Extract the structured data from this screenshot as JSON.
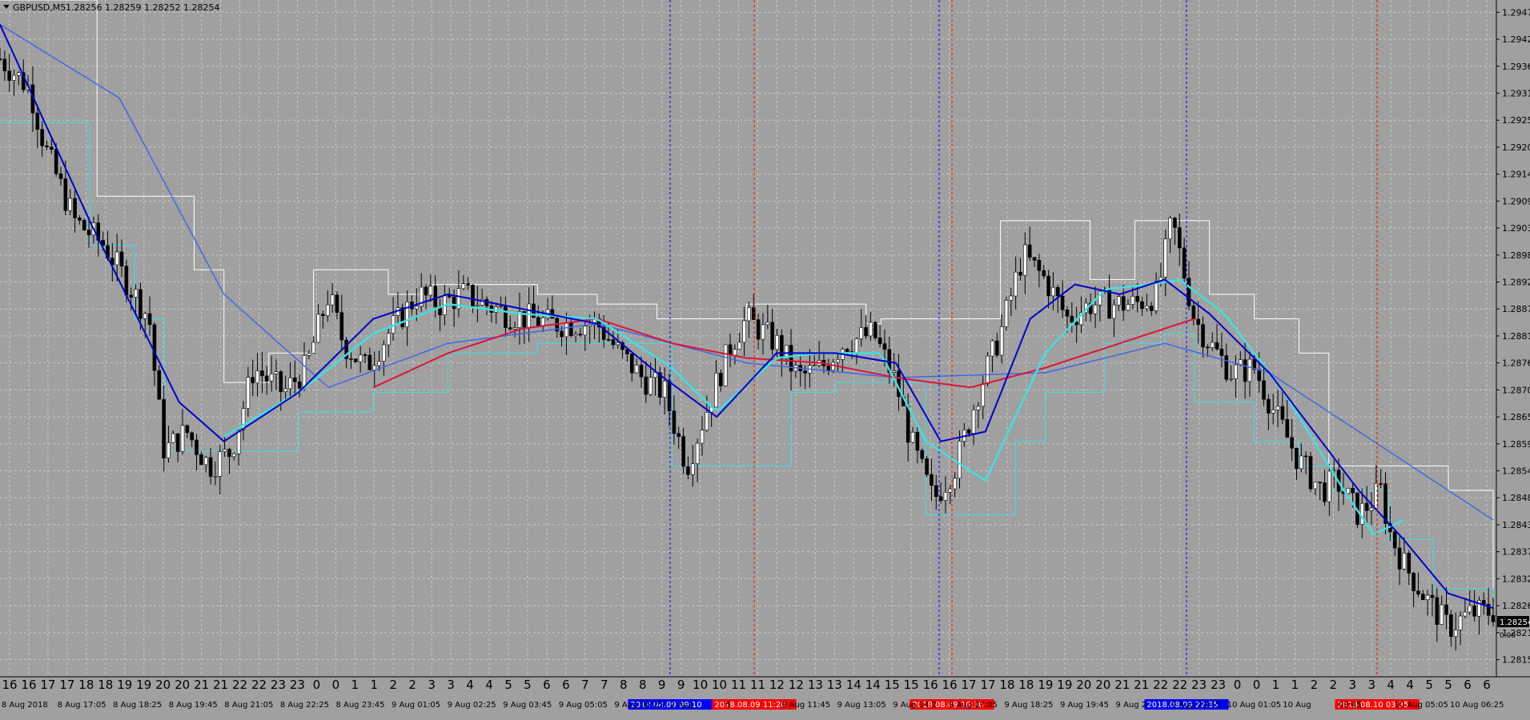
{
  "window": {
    "symbol_label": "GBPUSD,M5",
    "ohlc_label": "1.28256 1.28259 1.28252 1.28254",
    "current_price_label": "1.28254",
    "price_axis_extra": "0.00",
    "colors": {
      "background": "#a0a0a0",
      "grid": "#c8c8c8",
      "candles": "#000000",
      "white_channel": "#ffffff",
      "cyan_channel": "#40e0e0",
      "ma_fast": "#0000cc",
      "ma_slow": "#4169e1",
      "ma_cyan": "#40e0e0",
      "ma_red": "#dc143c",
      "marker_blue": "#0000ff",
      "marker_red": "#ff0000"
    }
  },
  "chart_data": {
    "type": "candlestick",
    "symbol": "GBPUSD",
    "timeframe": "M5",
    "y_range": [
      1.2812,
      1.295
    ],
    "y_ticks": [
      "1.29475",
      "1.29420",
      "1.29365",
      "1.29310",
      "1.29255",
      "1.29200",
      "1.29145",
      "1.29090",
      "1.29035",
      "1.28980",
      "1.28925",
      "1.28870",
      "1.28815",
      "1.28760",
      "1.28705",
      "1.28650",
      "1.28595",
      "1.28540",
      "1.28485",
      "1.28430",
      "1.28375",
      "1.28320",
      "1.28265",
      "1.28210",
      "1.28155"
    ],
    "hour_ticks": [
      "16",
      "16",
      "17",
      "17",
      "18",
      "18",
      "19",
      "19",
      "20",
      "20",
      "21",
      "21",
      "22",
      "22",
      "23",
      "23",
      "0",
      "0",
      "1",
      "1",
      "2",
      "2",
      "3",
      "3",
      "4",
      "4",
      "5",
      "5",
      "6",
      "6",
      "7",
      "7",
      "8",
      "8",
      "9",
      "9",
      "10",
      "10",
      "11",
      "11",
      "12",
      "12",
      "13",
      "13",
      "14",
      "14",
      "15",
      "15",
      "16",
      "16",
      "17",
      "17",
      "18",
      "18",
      "19",
      "19",
      "20",
      "20",
      "21",
      "21",
      "22",
      "22",
      "23",
      "23",
      "0",
      "0",
      "1",
      "1",
      "2",
      "2",
      "3",
      "3",
      "4",
      "4",
      "5",
      "5",
      "6",
      "6"
    ],
    "date_ticks": [
      "8 Aug 2018",
      "8 Aug 17:05",
      "8 Aug 18:25",
      "8 Aug 19:45",
      "8 Aug 21:05",
      "8 Aug 22:25",
      "8 Aug 23:45",
      "9 Aug 01:05",
      "9 Aug 02:25",
      "9 Aug 03:45",
      "9 Aug 05:05",
      "9 Aug 06:25",
      "9 Aug",
      "5",
      "9 Aug 11:45",
      "9 Aug 13:05",
      "9 Aug 14:2",
      "9 Aug 17:05",
      "9 Aug 18:25",
      "9 Aug 19:45",
      "9 Aug 2",
      "9 Aug 23:45",
      "10 Aug 01:05",
      "10 Aug",
      "03:45",
      "10 Aug 05:05",
      "10 Aug 06:25"
    ],
    "vertical_markers": [
      {
        "label": "2018.08.09 09:10",
        "color": "blue"
      },
      {
        "label": "2018.08.09 11:20",
        "color": "red"
      },
      {
        "label": "20",
        "color": "blue"
      },
      {
        "label": "2018.08.09 16:30",
        "color": "red"
      },
      {
        "label": "2018.08.09 22:35",
        "color": "blue"
      },
      {
        "label": "2018.08.10 03:35",
        "color": "red"
      }
    ],
    "price_anchors": [
      [
        0,
        1.2938
      ],
      [
        0.02,
        1.2932
      ],
      [
        0.03,
        1.292
      ],
      [
        0.05,
        1.2905
      ],
      [
        0.07,
        1.29
      ],
      [
        0.09,
        1.289
      ],
      [
        0.1,
        1.2885
      ],
      [
        0.105,
        1.287
      ],
      [
        0.11,
        1.2858
      ],
      [
        0.125,
        1.2862
      ],
      [
        0.14,
        1.2855
      ],
      [
        0.155,
        1.2858
      ],
      [
        0.17,
        1.2875
      ],
      [
        0.19,
        1.287
      ],
      [
        0.205,
        1.2875
      ],
      [
        0.22,
        1.289
      ],
      [
        0.23,
        1.288
      ],
      [
        0.245,
        1.2875
      ],
      [
        0.26,
        1.2882
      ],
      [
        0.28,
        1.289
      ],
      [
        0.295,
        1.2888
      ],
      [
        0.31,
        1.289
      ],
      [
        0.34,
        1.2886
      ],
      [
        0.37,
        1.2884
      ],
      [
        0.4,
        1.2884
      ],
      [
        0.415,
        1.2878
      ],
      [
        0.43,
        1.2873
      ],
      [
        0.445,
        1.287
      ],
      [
        0.46,
        1.2855
      ],
      [
        0.475,
        1.2868
      ],
      [
        0.49,
        1.288
      ],
      [
        0.5,
        1.2885
      ],
      [
        0.52,
        1.288
      ],
      [
        0.535,
        1.2873
      ],
      [
        0.55,
        1.2875
      ],
      [
        0.565,
        1.288
      ],
      [
        0.585,
        1.2882
      ],
      [
        0.6,
        1.2872
      ],
      [
        0.61,
        1.286
      ],
      [
        0.625,
        1.2848
      ],
      [
        0.64,
        1.2855
      ],
      [
        0.655,
        1.287
      ],
      [
        0.67,
        1.2882
      ],
      [
        0.685,
        1.2898
      ],
      [
        0.7,
        1.2893
      ],
      [
        0.715,
        1.2885
      ],
      [
        0.73,
        1.2888
      ],
      [
        0.745,
        1.2888
      ],
      [
        0.76,
        1.2888
      ],
      [
        0.775,
        1.289
      ],
      [
        0.785,
        1.2905
      ],
      [
        0.8,
        1.2885
      ],
      [
        0.81,
        1.288
      ],
      [
        0.825,
        1.2874
      ],
      [
        0.84,
        1.2875
      ],
      [
        0.855,
        1.2865
      ],
      [
        0.87,
        1.2856
      ],
      [
        0.885,
        1.285
      ],
      [
        0.895,
        1.2852
      ],
      [
        0.91,
        1.2845
      ],
      [
        0.925,
        1.285
      ],
      [
        0.93,
        1.2842
      ],
      [
        0.94,
        1.2835
      ],
      [
        0.955,
        1.2828
      ],
      [
        0.97,
        1.2822
      ],
      [
        0.985,
        1.2825
      ],
      [
        1.0,
        1.28254
      ]
    ],
    "ma_fast_anchors": [
      [
        0,
        1.2945
      ],
      [
        0.06,
        1.2905
      ],
      [
        0.12,
        1.2868
      ],
      [
        0.15,
        1.286
      ],
      [
        0.2,
        1.287
      ],
      [
        0.25,
        1.2885
      ],
      [
        0.3,
        1.289
      ],
      [
        0.35,
        1.2887
      ],
      [
        0.4,
        1.2884
      ],
      [
        0.44,
        1.2874
      ],
      [
        0.48,
        1.2865
      ],
      [
        0.52,
        1.2878
      ],
      [
        0.56,
        1.2878
      ],
      [
        0.6,
        1.2876
      ],
      [
        0.63,
        1.286
      ],
      [
        0.66,
        1.2862
      ],
      [
        0.69,
        1.2885
      ],
      [
        0.72,
        1.2892
      ],
      [
        0.75,
        1.289
      ],
      [
        0.78,
        1.2893
      ],
      [
        0.81,
        1.2886
      ],
      [
        0.85,
        1.2874
      ],
      [
        0.88,
        1.2862
      ],
      [
        0.91,
        1.285
      ],
      [
        0.94,
        1.284
      ],
      [
        0.97,
        1.2829
      ],
      [
        1.0,
        1.2826
      ]
    ],
    "ma_slow_anchors": [
      [
        0,
        1.2945
      ],
      [
        0.08,
        1.293
      ],
      [
        0.15,
        1.289
      ],
      [
        0.22,
        1.2871
      ],
      [
        0.3,
        1.288
      ],
      [
        0.4,
        1.2884
      ],
      [
        0.5,
        1.2876
      ],
      [
        0.6,
        1.2873
      ],
      [
        0.7,
        1.2874
      ],
      [
        0.78,
        1.288
      ],
      [
        0.85,
        1.2874
      ],
      [
        0.92,
        1.286
      ],
      [
        1.0,
        1.2844
      ]
    ],
    "ma_cyan_anchors": [
      [
        0.15,
        1.2861
      ],
      [
        0.2,
        1.287
      ],
      [
        0.25,
        1.2882
      ],
      [
        0.3,
        1.2888
      ],
      [
        0.35,
        1.2886
      ],
      [
        0.4,
        1.2885
      ],
      [
        0.45,
        1.2875
      ],
      [
        0.48,
        1.2866
      ],
      [
        0.52,
        1.2877
      ],
      [
        0.55,
        1.2878
      ],
      [
        0.59,
        1.2878
      ],
      [
        0.62,
        1.286
      ],
      [
        0.66,
        1.2852
      ],
      [
        0.7,
        1.2878
      ],
      [
        0.74,
        1.2891
      ],
      [
        0.77,
        1.2892
      ],
      [
        0.79,
        1.2893
      ],
      [
        0.82,
        1.2886
      ],
      [
        0.86,
        1.287
      ],
      [
        0.9,
        1.285
      ],
      [
        0.92,
        1.2841
      ],
      [
        0.94,
        1.2844
      ]
    ],
    "ma_red_anchors": [
      [
        0.25,
        1.2871
      ],
      [
        0.3,
        1.2878
      ],
      [
        0.35,
        1.2883
      ],
      [
        0.4,
        1.2885
      ],
      [
        0.45,
        1.288
      ],
      [
        0.5,
        1.2877
      ],
      [
        0.55,
        1.2876
      ],
      [
        0.6,
        1.2873
      ],
      [
        0.65,
        1.2871
      ],
      [
        0.7,
        1.2875
      ],
      [
        0.75,
        1.288
      ],
      [
        0.8,
        1.2885
      ]
    ],
    "channel_high_anchors": [
      [
        0,
        1.295
      ],
      [
        0.055,
        1.295
      ],
      [
        0.065,
        1.291
      ],
      [
        0.13,
        1.2895
      ],
      [
        0.15,
        1.2872
      ],
      [
        0.18,
        1.2878
      ],
      [
        0.21,
        1.2895
      ],
      [
        0.25,
        1.2895
      ],
      [
        0.26,
        1.289
      ],
      [
        0.29,
        1.2892
      ],
      [
        0.36,
        1.289
      ],
      [
        0.4,
        1.2888
      ],
      [
        0.44,
        1.2885
      ],
      [
        0.5,
        1.2888
      ],
      [
        0.53,
        1.2888
      ],
      [
        0.58,
        1.2884
      ],
      [
        0.59,
        1.2885
      ],
      [
        0.64,
        1.2885
      ],
      [
        0.67,
        1.2905
      ],
      [
        0.71,
        1.2905
      ],
      [
        0.73,
        1.2893
      ],
      [
        0.76,
        1.2905
      ],
      [
        0.79,
        1.2905
      ],
      [
        0.81,
        1.289
      ],
      [
        0.84,
        1.2885
      ],
      [
        0.87,
        1.2878
      ],
      [
        0.89,
        1.2855
      ],
      [
        0.92,
        1.2855
      ],
      [
        0.95,
        1.2855
      ],
      [
        0.97,
        1.285
      ],
      [
        1.0,
        1.283
      ]
    ],
    "channel_low_anchors": [
      [
        0,
        1.2925
      ],
      [
        0.03,
        1.2925
      ],
      [
        0.06,
        1.29
      ],
      [
        0.09,
        1.2885
      ],
      [
        0.11,
        1.2858
      ],
      [
        0.17,
        1.2858
      ],
      [
        0.2,
        1.2866
      ],
      [
        0.25,
        1.287
      ],
      [
        0.3,
        1.2878
      ],
      [
        0.36,
        1.288
      ],
      [
        0.4,
        1.288
      ],
      [
        0.45,
        1.2855
      ],
      [
        0.5,
        1.2855
      ],
      [
        0.53,
        1.287
      ],
      [
        0.56,
        1.2872
      ],
      [
        0.6,
        1.2872
      ],
      [
        0.62,
        1.2845
      ],
      [
        0.65,
        1.2845
      ],
      [
        0.68,
        1.286
      ],
      [
        0.7,
        1.287
      ],
      [
        0.74,
        1.288
      ],
      [
        0.78,
        1.2882
      ],
      [
        0.8,
        1.2868
      ],
      [
        0.84,
        1.286
      ],
      [
        0.87,
        1.2855
      ],
      [
        0.89,
        1.285
      ],
      [
        0.93,
        1.284
      ],
      [
        0.96,
        1.283
      ],
      [
        1.0,
        1.2823
      ]
    ]
  }
}
